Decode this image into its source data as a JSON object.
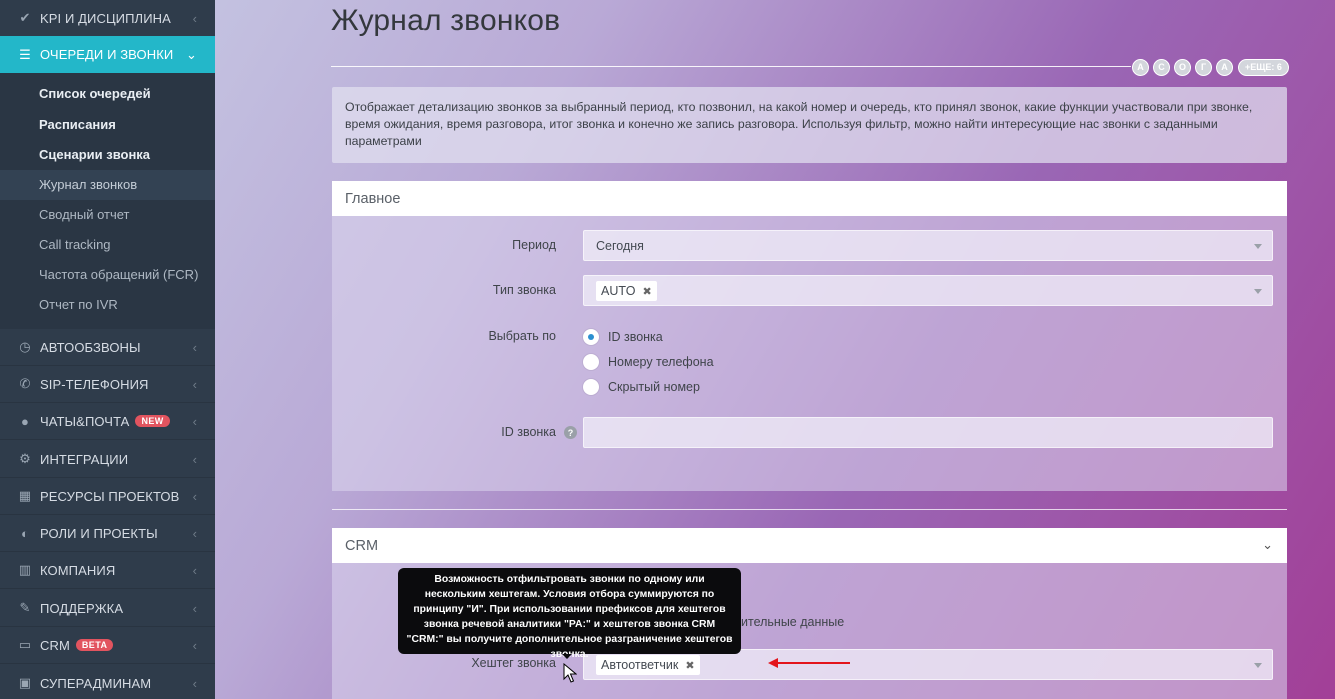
{
  "sidebar": {
    "items": [
      {
        "label": "KPI И ДИСЦИПЛИНА",
        "icon": "check-icon"
      },
      {
        "label": "ОЧЕРЕДИ И ЗВОНКИ",
        "icon": "list-icon"
      },
      {
        "label": "АВТООБЗВОНЫ",
        "icon": "clock-icon"
      },
      {
        "label": "SIP-ТЕЛЕФОНИЯ",
        "icon": "phone-icon"
      },
      {
        "label": "ЧАТЫ&ПОЧТА",
        "icon": "chat-icon",
        "badge": "NEW"
      },
      {
        "label": "ИНТЕГРАЦИИ",
        "icon": "gears-icon"
      },
      {
        "label": "РЕСУРСЫ ПРОЕКТОВ",
        "icon": "grid-icon"
      },
      {
        "label": "РОЛИ И ПРОЕКТЫ",
        "icon": "toggle-icon"
      },
      {
        "label": "КОМПАНИЯ",
        "icon": "bar-chart-icon"
      },
      {
        "label": "ПОДДЕРЖКА",
        "icon": "wrench-icon"
      },
      {
        "label": "CRM",
        "icon": "card-icon",
        "badge": "BETA"
      },
      {
        "label": "СУПЕРАДМИНАМ",
        "icon": "lock-icon"
      }
    ],
    "submenu": [
      "Список очередей",
      "Расписания",
      "Сценарии звонка",
      "Журнал звонков",
      "Сводный отчет",
      "Call tracking",
      "Частота обращений (FCR)",
      "Отчет по IVR"
    ]
  },
  "header": {
    "title": "Журнал звонков",
    "avatars": [
      "А",
      "С",
      "О",
      "Г",
      "А"
    ],
    "more": "+ЕЩЕ: 6"
  },
  "description": "Отображает детализацию звонков за выбранный период, кто позвонил, на какой номер и очередь, кто принял звонок, какие функции участвовали при звонке, время ожидания, время разговора, итог звонка и конечно же запись разговора. Используя фильтр, можно найти интересующие нас звонки с заданными параметрами",
  "main_panel": {
    "title": "Главное",
    "period_label": "Период",
    "period_value": "Сегодня",
    "call_type_label": "Тип звонка",
    "call_type_tag": "AUTO",
    "select_by_label": "Выбрать по",
    "radio_options": [
      "ID звонка",
      "Номеру телефона",
      "Скрытый номер"
    ],
    "call_id_label": "ID звонка"
  },
  "crm_panel": {
    "title": "CRM",
    "hidden_text": "ительные данные",
    "hashtag_label": "Хештег звонка",
    "hashtag_tag": "Автоответчик",
    "tooltip": "Возможность отфильтровать звонки по одному или нескольким хештегам. Условия отбора суммируются по принципу \"И\". При использовании префиксов для хештегов звонка речевой аналитики \"РА:\" и хештегов звонка CRM \"CRM:\" вы получите дополнительное разграничение хештегов звонка."
  },
  "colors": {
    "sidebar_bg": "#2f3c4b",
    "active_item": "#23b7c9",
    "badge": "#e2545f",
    "annotation_arrow": "#e3141b"
  }
}
